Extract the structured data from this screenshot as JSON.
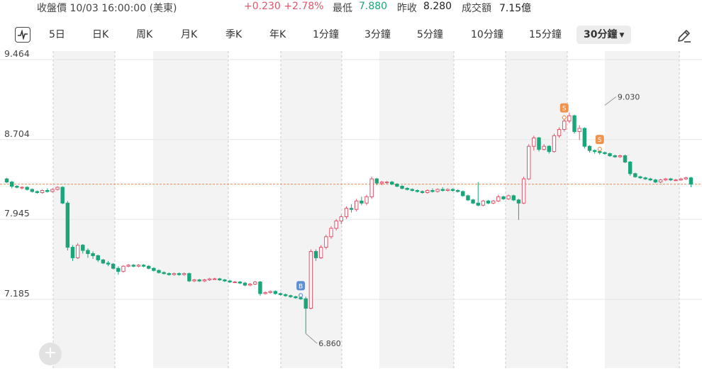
{
  "header": {
    "status_label": "收盤價 10/03 16:00:00 (美東)",
    "change": "+0.230 +2.78%",
    "low_label": "最低",
    "low_value": "7.880",
    "prev_close_label": "昨收",
    "prev_close_value": "8.280",
    "volume_label": "成交額",
    "volume_value": "7.15億"
  },
  "periods": [
    "5日",
    "日K",
    "周K",
    "月K",
    "季K",
    "年K",
    "1分鐘",
    "3分鐘",
    "5分鐘",
    "10分鐘",
    "15分鐘",
    "30分鐘"
  ],
  "active_period": "30分鐘",
  "icons": {
    "chart_toggle": "line-chart-icon",
    "draw": "pencil-icon",
    "add": "plus-icon"
  },
  "chart_data": {
    "type": "candlestick",
    "y_ticks": [
      "9.464",
      "8.704",
      "7.945",
      "7.185"
    ],
    "ylim": [
      6.78,
      9.52
    ],
    "grid": true,
    "ref_line": 8.28,
    "markers": [
      {
        "label": "B",
        "index": 58,
        "color": "#5b8fd6"
      },
      {
        "label": "S",
        "index": 110,
        "color": "#f0944d"
      },
      {
        "label": "S",
        "index": 117,
        "color": "#f0944d"
      }
    ],
    "annotations": [
      {
        "text": "9.030",
        "index": 118,
        "value": 9.03
      },
      {
        "text": "6.860",
        "index": 59,
        "value": 6.86
      }
    ],
    "colors": {
      "up": "#e0566b",
      "down": "#1aa57a",
      "ref": "#ec8a5a"
    },
    "ohlc": [
      [
        8.33,
        8.34,
        8.29,
        8.3
      ],
      [
        8.3,
        8.31,
        8.24,
        8.26
      ],
      [
        8.26,
        8.27,
        8.24,
        8.25
      ],
      [
        8.25,
        8.26,
        8.23,
        8.25
      ],
      [
        8.25,
        8.26,
        8.22,
        8.23
      ],
      [
        8.23,
        8.24,
        8.2,
        8.21
      ],
      [
        8.21,
        8.22,
        8.19,
        8.2
      ],
      [
        8.2,
        8.23,
        8.19,
        8.22
      ],
      [
        8.22,
        8.24,
        8.2,
        8.21
      ],
      [
        8.21,
        8.24,
        8.2,
        8.23
      ],
      [
        8.23,
        8.26,
        8.22,
        8.25
      ],
      [
        8.25,
        8.26,
        8.09,
        8.1
      ],
      [
        8.1,
        8.12,
        7.65,
        7.68
      ],
      [
        7.68,
        7.7,
        7.55,
        7.58
      ],
      [
        7.58,
        7.72,
        7.57,
        7.7
      ],
      [
        7.7,
        7.71,
        7.62,
        7.65
      ],
      [
        7.65,
        7.67,
        7.58,
        7.62
      ],
      [
        7.62,
        7.64,
        7.57,
        7.6
      ],
      [
        7.6,
        7.61,
        7.54,
        7.56
      ],
      [
        7.56,
        7.57,
        7.52,
        7.53
      ],
      [
        7.53,
        7.55,
        7.5,
        7.52
      ],
      [
        7.52,
        7.53,
        7.47,
        7.48
      ],
      [
        7.48,
        7.5,
        7.42,
        7.45
      ],
      [
        7.45,
        7.51,
        7.44,
        7.5
      ],
      [
        7.5,
        7.52,
        7.49,
        7.51
      ],
      [
        7.51,
        7.52,
        7.49,
        7.5
      ],
      [
        7.5,
        7.52,
        7.49,
        7.51
      ],
      [
        7.51,
        7.52,
        7.49,
        7.5
      ],
      [
        7.5,
        7.51,
        7.47,
        7.48
      ],
      [
        7.48,
        7.49,
        7.45,
        7.46
      ],
      [
        7.46,
        7.47,
        7.43,
        7.44
      ],
      [
        7.44,
        7.45,
        7.42,
        7.43
      ],
      [
        7.43,
        7.44,
        7.41,
        7.42
      ],
      [
        7.42,
        7.44,
        7.41,
        7.43
      ],
      [
        7.43,
        7.44,
        7.41,
        7.42
      ],
      [
        7.42,
        7.44,
        7.41,
        7.43
      ],
      [
        7.43,
        7.44,
        7.35,
        7.36
      ],
      [
        7.36,
        7.38,
        7.35,
        7.37
      ],
      [
        7.37,
        7.38,
        7.35,
        7.36
      ],
      [
        7.36,
        7.38,
        7.35,
        7.37
      ],
      [
        7.37,
        7.39,
        7.36,
        7.38
      ],
      [
        7.38,
        7.39,
        7.37,
        7.38
      ],
      [
        7.38,
        7.39,
        7.36,
        7.37
      ],
      [
        7.37,
        7.38,
        7.35,
        7.36
      ],
      [
        7.36,
        7.37,
        7.34,
        7.35
      ],
      [
        7.35,
        7.36,
        7.34,
        7.35
      ],
      [
        7.35,
        7.36,
        7.33,
        7.34
      ],
      [
        7.34,
        7.35,
        7.31,
        7.32
      ],
      [
        7.32,
        7.34,
        7.31,
        7.33
      ],
      [
        7.33,
        7.36,
        7.32,
        7.35
      ],
      [
        7.35,
        7.36,
        7.22,
        7.24
      ],
      [
        7.24,
        7.26,
        7.23,
        7.25
      ],
      [
        7.25,
        7.27,
        7.24,
        7.26
      ],
      [
        7.26,
        7.27,
        7.23,
        7.24
      ],
      [
        7.24,
        7.25,
        7.22,
        7.23
      ],
      [
        7.23,
        7.24,
        7.21,
        7.22
      ],
      [
        7.22,
        7.23,
        7.2,
        7.21
      ],
      [
        7.21,
        7.22,
        7.19,
        7.2
      ],
      [
        7.2,
        7.21,
        7.18,
        7.19
      ],
      [
        7.19,
        7.21,
        6.86,
        7.1
      ],
      [
        7.1,
        7.66,
        7.09,
        7.64
      ],
      [
        7.64,
        7.66,
        7.55,
        7.58
      ],
      [
        7.58,
        7.7,
        7.57,
        7.68
      ],
      [
        7.68,
        7.8,
        7.66,
        7.78
      ],
      [
        7.78,
        7.88,
        7.76,
        7.86
      ],
      [
        7.86,
        7.95,
        7.84,
        7.93
      ],
      [
        7.93,
        7.99,
        7.9,
        7.97
      ],
      [
        7.97,
        8.07,
        7.95,
        8.05
      ],
      [
        8.05,
        8.09,
        8.01,
        8.04
      ],
      [
        8.04,
        8.14,
        8.02,
        8.12
      ],
      [
        8.12,
        8.16,
        8.08,
        8.1
      ],
      [
        8.1,
        8.18,
        8.08,
        8.16
      ],
      [
        8.16,
        8.35,
        8.14,
        8.33
      ],
      [
        8.33,
        8.34,
        8.27,
        8.29
      ],
      [
        8.29,
        8.31,
        8.27,
        8.3
      ],
      [
        8.3,
        8.31,
        8.28,
        8.3
      ],
      [
        8.3,
        8.31,
        8.27,
        8.28
      ],
      [
        8.28,
        8.29,
        8.25,
        8.26
      ],
      [
        8.26,
        8.27,
        8.23,
        8.24
      ],
      [
        8.24,
        8.25,
        8.22,
        8.23
      ],
      [
        8.23,
        8.24,
        8.21,
        8.22
      ],
      [
        8.22,
        8.23,
        8.2,
        8.21
      ],
      [
        8.21,
        8.22,
        8.19,
        8.2
      ],
      [
        8.2,
        8.23,
        8.19,
        8.22
      ],
      [
        8.22,
        8.24,
        8.2,
        8.21
      ],
      [
        8.21,
        8.24,
        8.2,
        8.23
      ],
      [
        8.23,
        8.25,
        8.21,
        8.22
      ],
      [
        8.22,
        8.24,
        8.21,
        8.23
      ],
      [
        8.23,
        8.24,
        8.21,
        8.22
      ],
      [
        8.22,
        8.23,
        8.2,
        8.21
      ],
      [
        8.21,
        8.22,
        8.16,
        8.17
      ],
      [
        8.17,
        8.18,
        8.12,
        8.13
      ],
      [
        8.13,
        8.14,
        8.09,
        8.1
      ],
      [
        8.1,
        8.3,
        8.07,
        8.08
      ],
      [
        8.08,
        8.13,
        8.07,
        8.12
      ],
      [
        8.12,
        8.13,
        8.09,
        8.1
      ],
      [
        8.1,
        8.13,
        8.09,
        8.12
      ],
      [
        8.12,
        8.18,
        8.11,
        8.16
      ],
      [
        8.16,
        8.17,
        8.13,
        8.14
      ],
      [
        8.14,
        8.18,
        8.13,
        8.17
      ],
      [
        8.17,
        8.18,
        8.12,
        8.13
      ],
      [
        8.13,
        8.14,
        7.94,
        8.1
      ],
      [
        8.1,
        8.35,
        8.09,
        8.33
      ],
      [
        8.33,
        8.66,
        8.32,
        8.64
      ],
      [
        8.64,
        8.74,
        8.6,
        8.72
      ],
      [
        8.72,
        8.73,
        8.59,
        8.61
      ],
      [
        8.61,
        8.66,
        8.6,
        8.64
      ],
      [
        8.64,
        8.65,
        8.57,
        8.59
      ],
      [
        8.59,
        8.76,
        8.58,
        8.74
      ],
      [
        8.74,
        8.82,
        8.72,
        8.8
      ],
      [
        8.8,
        8.9,
        8.78,
        8.88
      ],
      [
        8.88,
        8.96,
        8.86,
        8.93
      ],
      [
        8.93,
        8.94,
        8.76,
        8.78
      ],
      [
        8.78,
        8.84,
        8.7,
        8.81
      ],
      [
        8.81,
        8.82,
        8.62,
        8.64
      ],
      [
        8.64,
        8.65,
        8.58,
        8.6
      ],
      [
        8.6,
        8.61,
        8.57,
        8.59
      ],
      [
        8.59,
        8.6,
        8.56,
        8.58
      ],
      [
        8.58,
        8.59,
        8.56,
        8.57
      ],
      [
        8.57,
        8.58,
        8.54,
        8.55
      ],
      [
        8.55,
        8.56,
        8.53,
        8.54
      ],
      [
        8.54,
        8.56,
        8.53,
        8.55
      ],
      [
        8.55,
        8.56,
        8.48,
        8.49
      ],
      [
        8.49,
        8.5,
        8.36,
        8.38
      ],
      [
        8.38,
        8.39,
        8.34,
        8.35
      ],
      [
        8.35,
        8.36,
        8.33,
        8.34
      ],
      [
        8.34,
        8.35,
        8.32,
        8.33
      ],
      [
        8.33,
        8.34,
        8.31,
        8.32
      ],
      [
        8.32,
        8.33,
        8.29,
        8.3
      ],
      [
        8.3,
        8.33,
        8.29,
        8.32
      ],
      [
        8.32,
        8.34,
        8.31,
        8.33
      ],
      [
        8.33,
        8.34,
        8.31,
        8.32
      ],
      [
        8.32,
        8.33,
        8.31,
        8.32
      ],
      [
        8.32,
        8.34,
        8.31,
        8.33
      ],
      [
        8.33,
        8.35,
        8.32,
        8.34
      ],
      [
        8.34,
        8.35,
        8.25,
        8.28
      ]
    ]
  }
}
